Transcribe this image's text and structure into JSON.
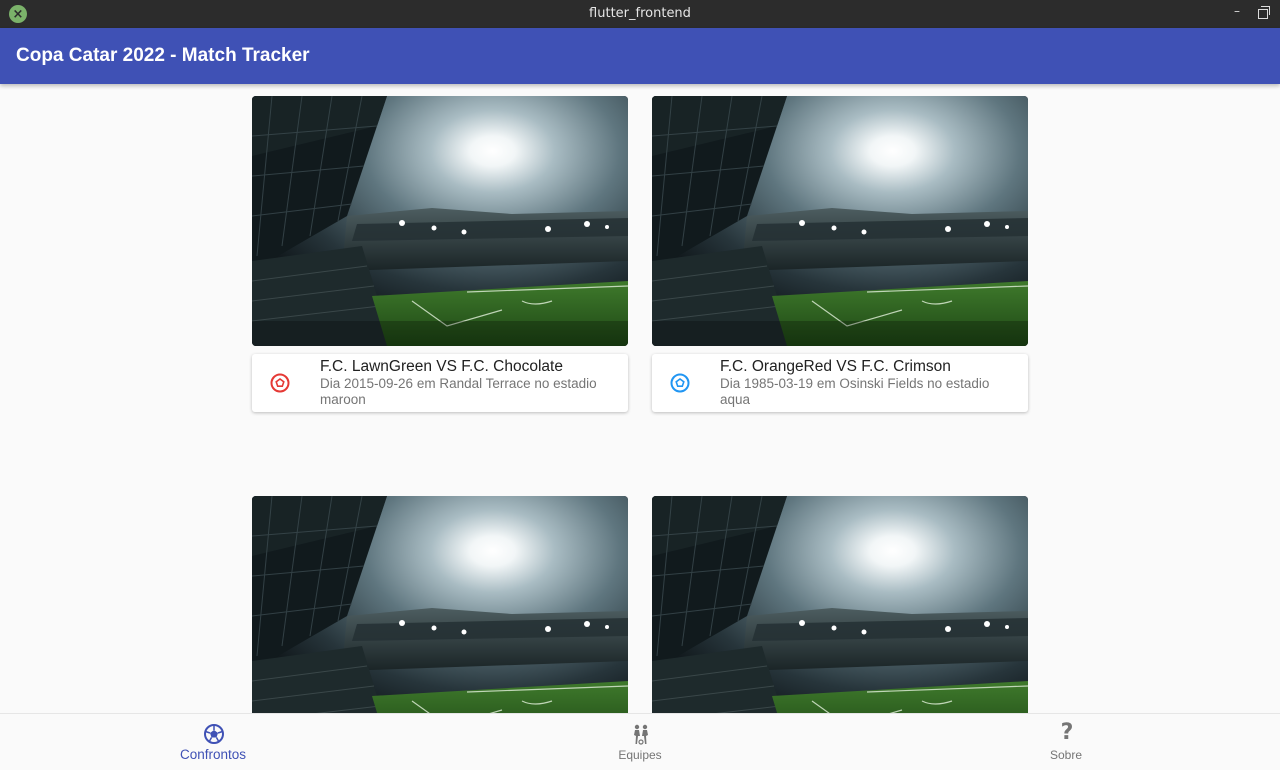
{
  "window": {
    "title": "flutter_frontend",
    "close_icon": "close-icon",
    "minimize_label": "–",
    "maximize_icon": "restore-icon"
  },
  "appbar": {
    "title": "Copa Catar 2022 - Match Tracker"
  },
  "matches": [
    {
      "title": "F.C. LawnGreen VS F.C. Chocolate",
      "subtitle": "Dia 2015-09-26 em Randal Terrace no estadio maroon",
      "icon": "soccer-ball-icon",
      "icon_color": "#e53935"
    },
    {
      "title": "F.C. OrangeRed VS F.C. Crimson",
      "subtitle": "Dia 1985-03-19 em Osinski Fields no estadio aqua",
      "icon": "soccer-ball-icon",
      "icon_color": "#2196f3"
    },
    {
      "title": "",
      "subtitle": ""
    },
    {
      "title": "",
      "subtitle": ""
    }
  ],
  "bottom_nav": {
    "items": [
      {
        "label": "Confrontos",
        "icon": "soccer-ball-icon",
        "active": true
      },
      {
        "label": "Equipes",
        "icon": "players-icon",
        "active": false
      },
      {
        "label": "Sobre",
        "icon": "question-icon",
        "active": false
      }
    ],
    "question_glyph": "?"
  },
  "colors": {
    "primary": "#3f51b5",
    "titlebar": "#2c2c2c",
    "background": "#fafafa"
  }
}
